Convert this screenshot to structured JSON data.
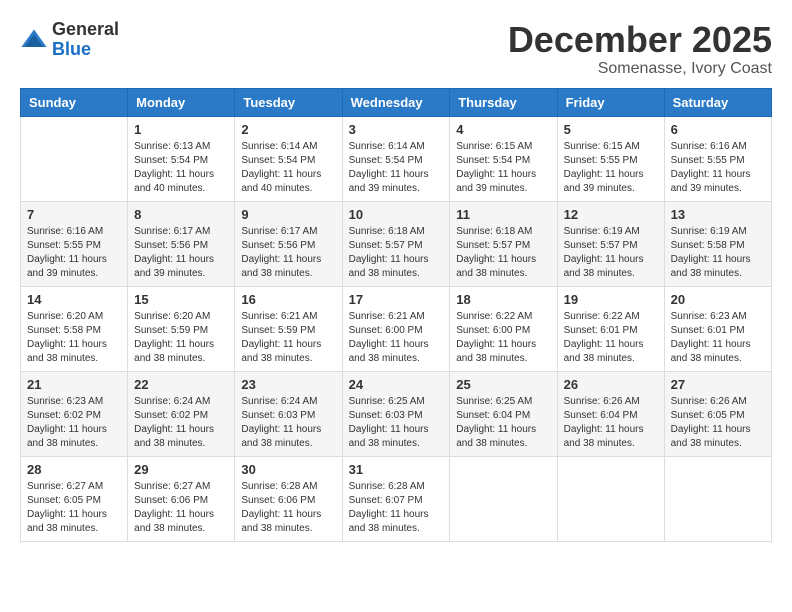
{
  "logo": {
    "general": "General",
    "blue": "Blue"
  },
  "title": "December 2025",
  "location": "Somenasse, Ivory Coast",
  "weekdays": [
    "Sunday",
    "Monday",
    "Tuesday",
    "Wednesday",
    "Thursday",
    "Friday",
    "Saturday"
  ],
  "weeks": [
    [
      {
        "day": "",
        "sunrise": "",
        "sunset": "",
        "daylight": ""
      },
      {
        "day": "1",
        "sunrise": "Sunrise: 6:13 AM",
        "sunset": "Sunset: 5:54 PM",
        "daylight": "Daylight: 11 hours and 40 minutes."
      },
      {
        "day": "2",
        "sunrise": "Sunrise: 6:14 AM",
        "sunset": "Sunset: 5:54 PM",
        "daylight": "Daylight: 11 hours and 40 minutes."
      },
      {
        "day": "3",
        "sunrise": "Sunrise: 6:14 AM",
        "sunset": "Sunset: 5:54 PM",
        "daylight": "Daylight: 11 hours and 39 minutes."
      },
      {
        "day": "4",
        "sunrise": "Sunrise: 6:15 AM",
        "sunset": "Sunset: 5:54 PM",
        "daylight": "Daylight: 11 hours and 39 minutes."
      },
      {
        "day": "5",
        "sunrise": "Sunrise: 6:15 AM",
        "sunset": "Sunset: 5:55 PM",
        "daylight": "Daylight: 11 hours and 39 minutes."
      },
      {
        "day": "6",
        "sunrise": "Sunrise: 6:16 AM",
        "sunset": "Sunset: 5:55 PM",
        "daylight": "Daylight: 11 hours and 39 minutes."
      }
    ],
    [
      {
        "day": "7",
        "sunrise": "Sunrise: 6:16 AM",
        "sunset": "Sunset: 5:55 PM",
        "daylight": "Daylight: 11 hours and 39 minutes."
      },
      {
        "day": "8",
        "sunrise": "Sunrise: 6:17 AM",
        "sunset": "Sunset: 5:56 PM",
        "daylight": "Daylight: 11 hours and 39 minutes."
      },
      {
        "day": "9",
        "sunrise": "Sunrise: 6:17 AM",
        "sunset": "Sunset: 5:56 PM",
        "daylight": "Daylight: 11 hours and 38 minutes."
      },
      {
        "day": "10",
        "sunrise": "Sunrise: 6:18 AM",
        "sunset": "Sunset: 5:57 PM",
        "daylight": "Daylight: 11 hours and 38 minutes."
      },
      {
        "day": "11",
        "sunrise": "Sunrise: 6:18 AM",
        "sunset": "Sunset: 5:57 PM",
        "daylight": "Daylight: 11 hours and 38 minutes."
      },
      {
        "day": "12",
        "sunrise": "Sunrise: 6:19 AM",
        "sunset": "Sunset: 5:57 PM",
        "daylight": "Daylight: 11 hours and 38 minutes."
      },
      {
        "day": "13",
        "sunrise": "Sunrise: 6:19 AM",
        "sunset": "Sunset: 5:58 PM",
        "daylight": "Daylight: 11 hours and 38 minutes."
      }
    ],
    [
      {
        "day": "14",
        "sunrise": "Sunrise: 6:20 AM",
        "sunset": "Sunset: 5:58 PM",
        "daylight": "Daylight: 11 hours and 38 minutes."
      },
      {
        "day": "15",
        "sunrise": "Sunrise: 6:20 AM",
        "sunset": "Sunset: 5:59 PM",
        "daylight": "Daylight: 11 hours and 38 minutes."
      },
      {
        "day": "16",
        "sunrise": "Sunrise: 6:21 AM",
        "sunset": "Sunset: 5:59 PM",
        "daylight": "Daylight: 11 hours and 38 minutes."
      },
      {
        "day": "17",
        "sunrise": "Sunrise: 6:21 AM",
        "sunset": "Sunset: 6:00 PM",
        "daylight": "Daylight: 11 hours and 38 minutes."
      },
      {
        "day": "18",
        "sunrise": "Sunrise: 6:22 AM",
        "sunset": "Sunset: 6:00 PM",
        "daylight": "Daylight: 11 hours and 38 minutes."
      },
      {
        "day": "19",
        "sunrise": "Sunrise: 6:22 AM",
        "sunset": "Sunset: 6:01 PM",
        "daylight": "Daylight: 11 hours and 38 minutes."
      },
      {
        "day": "20",
        "sunrise": "Sunrise: 6:23 AM",
        "sunset": "Sunset: 6:01 PM",
        "daylight": "Daylight: 11 hours and 38 minutes."
      }
    ],
    [
      {
        "day": "21",
        "sunrise": "Sunrise: 6:23 AM",
        "sunset": "Sunset: 6:02 PM",
        "daylight": "Daylight: 11 hours and 38 minutes."
      },
      {
        "day": "22",
        "sunrise": "Sunrise: 6:24 AM",
        "sunset": "Sunset: 6:02 PM",
        "daylight": "Daylight: 11 hours and 38 minutes."
      },
      {
        "day": "23",
        "sunrise": "Sunrise: 6:24 AM",
        "sunset": "Sunset: 6:03 PM",
        "daylight": "Daylight: 11 hours and 38 minutes."
      },
      {
        "day": "24",
        "sunrise": "Sunrise: 6:25 AM",
        "sunset": "Sunset: 6:03 PM",
        "daylight": "Daylight: 11 hours and 38 minutes."
      },
      {
        "day": "25",
        "sunrise": "Sunrise: 6:25 AM",
        "sunset": "Sunset: 6:04 PM",
        "daylight": "Daylight: 11 hours and 38 minutes."
      },
      {
        "day": "26",
        "sunrise": "Sunrise: 6:26 AM",
        "sunset": "Sunset: 6:04 PM",
        "daylight": "Daylight: 11 hours and 38 minutes."
      },
      {
        "day": "27",
        "sunrise": "Sunrise: 6:26 AM",
        "sunset": "Sunset: 6:05 PM",
        "daylight": "Daylight: 11 hours and 38 minutes."
      }
    ],
    [
      {
        "day": "28",
        "sunrise": "Sunrise: 6:27 AM",
        "sunset": "Sunset: 6:05 PM",
        "daylight": "Daylight: 11 hours and 38 minutes."
      },
      {
        "day": "29",
        "sunrise": "Sunrise: 6:27 AM",
        "sunset": "Sunset: 6:06 PM",
        "daylight": "Daylight: 11 hours and 38 minutes."
      },
      {
        "day": "30",
        "sunrise": "Sunrise: 6:28 AM",
        "sunset": "Sunset: 6:06 PM",
        "daylight": "Daylight: 11 hours and 38 minutes."
      },
      {
        "day": "31",
        "sunrise": "Sunrise: 6:28 AM",
        "sunset": "Sunset: 6:07 PM",
        "daylight": "Daylight: 11 hours and 38 minutes."
      },
      {
        "day": "",
        "sunrise": "",
        "sunset": "",
        "daylight": ""
      },
      {
        "day": "",
        "sunrise": "",
        "sunset": "",
        "daylight": ""
      },
      {
        "day": "",
        "sunrise": "",
        "sunset": "",
        "daylight": ""
      }
    ]
  ]
}
